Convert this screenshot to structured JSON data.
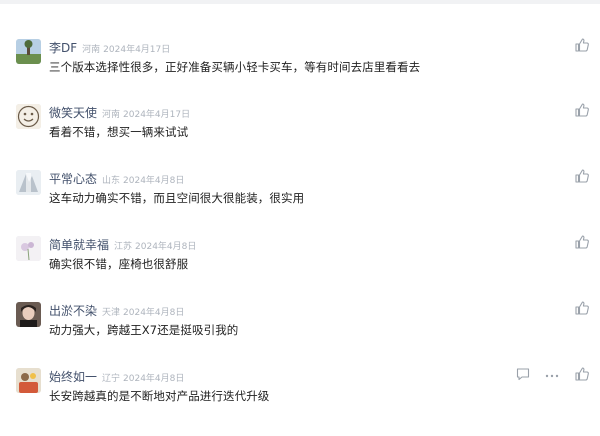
{
  "comments": [
    {
      "name": "李DF",
      "region": "河南",
      "date": "2024年4月17日",
      "text": "三个版本选择性很多，正好准备买辆小轻卡买车，等有时间去店里看看去"
    },
    {
      "name": "微笑天使",
      "region": "河南",
      "date": "2024年4月17日",
      "text": "看着不错，想买一辆来试试"
    },
    {
      "name": "平常心态",
      "region": "山东",
      "date": "2024年4月8日",
      "text": "这车动力确实不错，而且空间很大很能装，很实用"
    },
    {
      "name": "简单就幸福",
      "region": "江苏",
      "date": "2024年4月8日",
      "text": "确实很不错，座椅也很舒服"
    },
    {
      "name": "出淤不染",
      "region": "天津",
      "date": "2024年4月8日",
      "text": "动力强大，跨越王X7还是挺吸引我的"
    },
    {
      "name": "始终如一",
      "region": "辽宁",
      "date": "2024年4月8日",
      "text": "长安跨越真的是不断地对产品进行迭代升级"
    }
  ],
  "icons": {
    "like": "thumbs-up-icon",
    "reply": "comment-icon",
    "more": "more-icon"
  },
  "colors": {
    "name": "#42506b",
    "meta": "#aeb4bd",
    "text": "#222222",
    "icon": "#9aa1aa"
  }
}
